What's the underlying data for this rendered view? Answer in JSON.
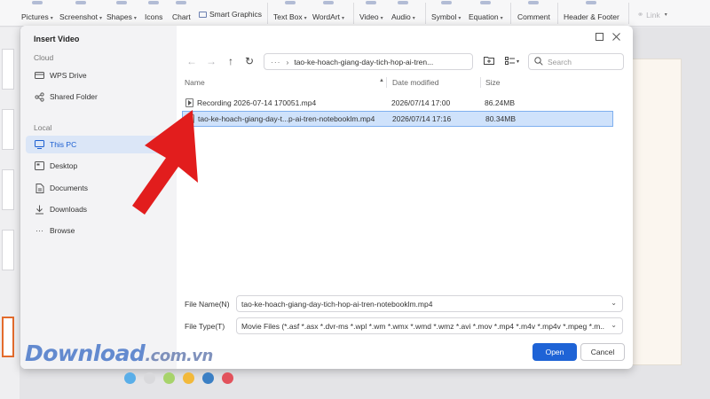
{
  "ribbon": {
    "items": [
      {
        "label": "Pictures",
        "icon": "picture-icon"
      },
      {
        "label": "Screenshot",
        "icon": "screenshot-icon"
      },
      {
        "label": "Shapes",
        "icon": "shapes-icon"
      },
      {
        "label": "Icons",
        "icon": "icons-icon"
      },
      {
        "label": "Chart",
        "icon": "chart-icon"
      },
      {
        "label": "Smart Graphics",
        "icon": "smart-graphics-icon"
      },
      {
        "label": "Text Box",
        "icon": "text-box-icon"
      },
      {
        "label": "WordArt",
        "icon": "wordart-icon"
      },
      {
        "label": "Video",
        "icon": "video-icon"
      },
      {
        "label": "Audio",
        "icon": "audio-icon"
      },
      {
        "label": "Symbol",
        "icon": "symbol-icon"
      },
      {
        "label": "Equation",
        "icon": "equation-icon"
      },
      {
        "label": "Comment",
        "icon": "comment-icon"
      },
      {
        "label": "Header & Footer",
        "icon": "header-footer-icon"
      },
      {
        "label": "Link",
        "icon": "link-icon"
      }
    ]
  },
  "dialog": {
    "title": "Insert Video",
    "sidebar": {
      "cloud_header": "Cloud",
      "cloud_items": [
        "WPS Drive",
        "Shared Folder"
      ],
      "local_header": "Local",
      "local_items": [
        "This PC",
        "Desktop",
        "Documents",
        "Downloads",
        "Browse"
      ],
      "active": "This PC"
    },
    "path": "tao-ke-hoach-giang-day-tich-hop-ai-tren...",
    "search_placeholder": "Search",
    "columns": {
      "name": "Name",
      "date": "Date modified",
      "size": "Size"
    },
    "files": [
      {
        "name": "Recording 2026-07-14 170051.mp4",
        "date": "2026/07/14 17:00",
        "size": "86.24MB",
        "selected": false
      },
      {
        "name": "tao-ke-hoach-giang-day-t...p-ai-tren-notebooklm.mp4",
        "date": "2026/07/14 17:16",
        "size": "80.34MB",
        "selected": true
      }
    ],
    "file_name_label": "File Name(N)",
    "file_name_value": "tao-ke-hoach-giang-day-tich-hop-ai-tren-notebooklm.mp4",
    "file_type_label": "File Type(T)",
    "file_type_value": "Movie Files (*.asf *.asx *.dvr-ms *.wpl *.wm *.wmx *.wmd *.wmz *.avi *.mov *.mp4 *.m4v *.mp4v *.mpeg *.m...",
    "open_label": "Open",
    "cancel_label": "Cancel"
  },
  "watermark": {
    "brand": "Download",
    "tld": ".com.vn",
    "dot_colors": [
      "#5aaee8",
      "#d9d9dc",
      "#a7d36b",
      "#f2b93b",
      "#3b7fc4",
      "#e2525c"
    ]
  },
  "colors": {
    "accent": "#1e63d6",
    "selection": "#cfe2fb",
    "arrow": "#e21d1d"
  }
}
